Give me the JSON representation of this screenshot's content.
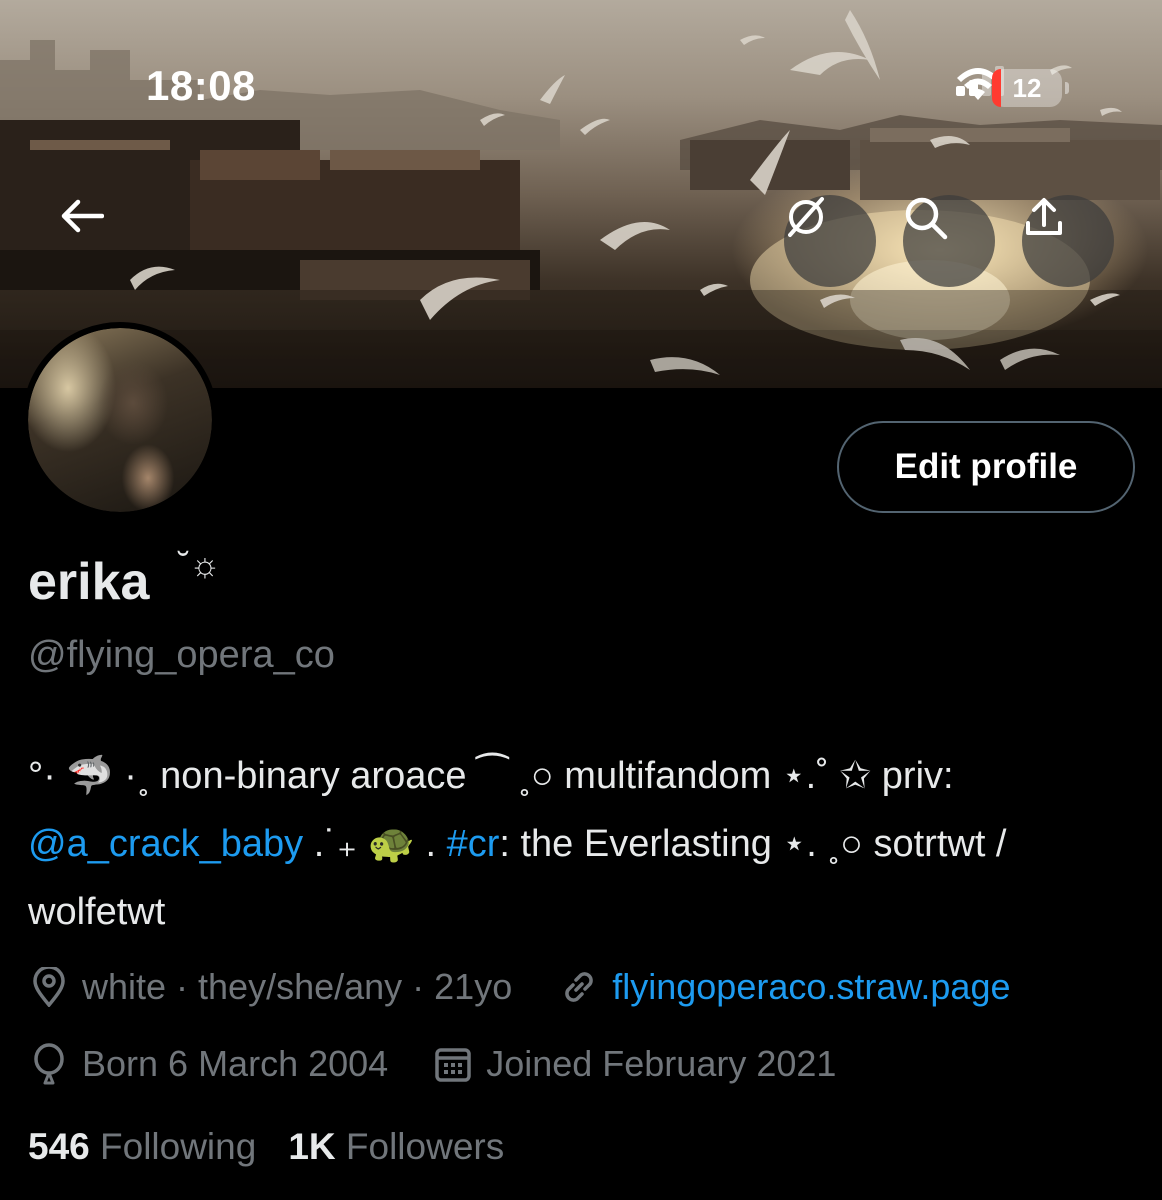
{
  "status_bar": {
    "time": "18:08",
    "battery_level": "12",
    "battery_color": "#ff3b30",
    "icons": [
      "cellular-signal-icon",
      "wifi-icon",
      "battery-icon"
    ]
  },
  "header": {
    "back_icon": "arrow-left-icon",
    "actions": [
      "grok-icon",
      "search-icon",
      "share-icon"
    ]
  },
  "profile": {
    "edit_button_label": "Edit profile",
    "display_name": "erika",
    "name_decoration": "˘☼",
    "handle": "@flying_opera_co",
    "bio_lines": [
      [
        {
          "text": "°· ",
          "link": false
        },
        {
          "text": "🦈",
          "link": false
        },
        {
          "text": " ·˳ non-binary aroace ⁀ ˳○ multifandom ⋆.˚ ",
          "link": false
        },
        {
          "text": "✩",
          "link": false
        },
        {
          "text": " priv:",
          "link": false
        }
      ],
      [
        {
          "text": "@a_crack_baby",
          "link": true
        },
        {
          "text": " .˙₊ ",
          "link": false
        },
        {
          "text": "🐢",
          "link": false
        },
        {
          "text": " . ",
          "link": false
        },
        {
          "text": "#cr",
          "link": true
        },
        {
          "text": ": the Everlasting ⋆. ˳○ sotrtwt /",
          "link": false
        }
      ],
      [
        {
          "text": "wolfetwt",
          "link": false
        }
      ]
    ],
    "location": "white · they/she/any · 21yo",
    "website": "flyingoperaco.straw.page",
    "birthday": "Born 6 March 2004",
    "joined": "Joined February 2021",
    "following_count": "546",
    "following_label": "Following",
    "followers_count": "1K",
    "followers_label": "Followers"
  },
  "colors": {
    "background": "#000000",
    "text_primary": "#e7e9ea",
    "text_secondary": "#71767b",
    "link": "#1d9bf0",
    "button_border": "#536471"
  }
}
